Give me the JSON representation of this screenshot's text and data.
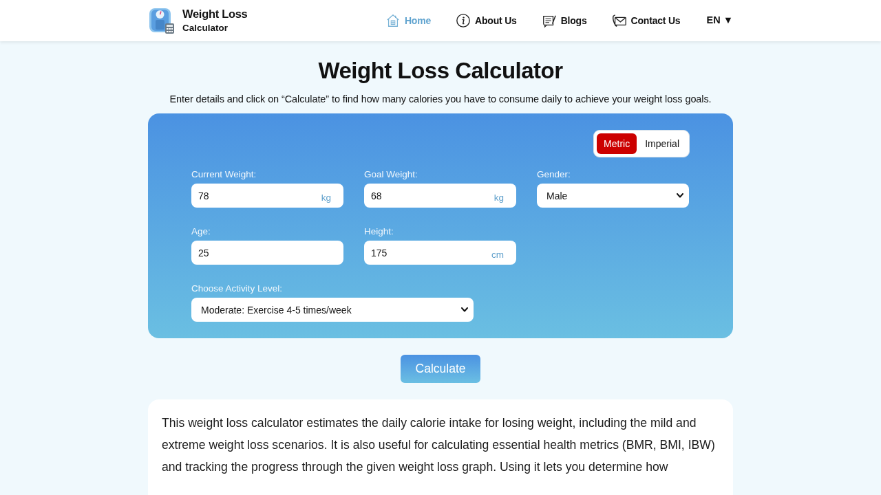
{
  "header": {
    "logo": {
      "title": "Weight Loss",
      "subtitle": "Calculator"
    },
    "nav": [
      {
        "label": "Home",
        "selected": true
      },
      {
        "label": "About Us",
        "selected": false
      },
      {
        "label": "Blogs",
        "selected": false
      },
      {
        "label": "Contact Us",
        "selected": false
      }
    ],
    "language": "EN ▼"
  },
  "title": "Weight Loss Calculator",
  "subtitle": "Enter details and click on “Calculate” to find how many calories you have to consume daily to achieve your weight loss goals.",
  "form": {
    "unit_toggle": [
      {
        "label": "Metric",
        "selected": true
      },
      {
        "label": "Imperial",
        "selected": false
      }
    ],
    "rows": [
      [
        {
          "kind": "input",
          "label": "Current Weight:",
          "value": "78",
          "unit": "kg"
        },
        {
          "kind": "input",
          "label": "Goal Weight:",
          "value": "68",
          "unit": "kg"
        },
        {
          "kind": "select",
          "label": "Gender:",
          "value": "Male"
        }
      ],
      [
        {
          "kind": "input",
          "label": "Age:",
          "value": "25"
        },
        {
          "kind": "input",
          "label": "Height:",
          "value": "175",
          "unit": "cm"
        }
      ],
      [
        {
          "kind": "select",
          "label": "Choose Activity Level:",
          "value": "Moderate: Exercise 4-5 times/week"
        }
      ]
    ],
    "button": "Calculate"
  },
  "description": "This weight loss calculator estimates the daily calorie intake for losing weight, including the mild and extreme weight loss scenarios. It is also useful for calculating essential health metrics (BMR, BMI, IBW) and tracking the progress through the given weight loss graph. Using it lets you determine how"
}
